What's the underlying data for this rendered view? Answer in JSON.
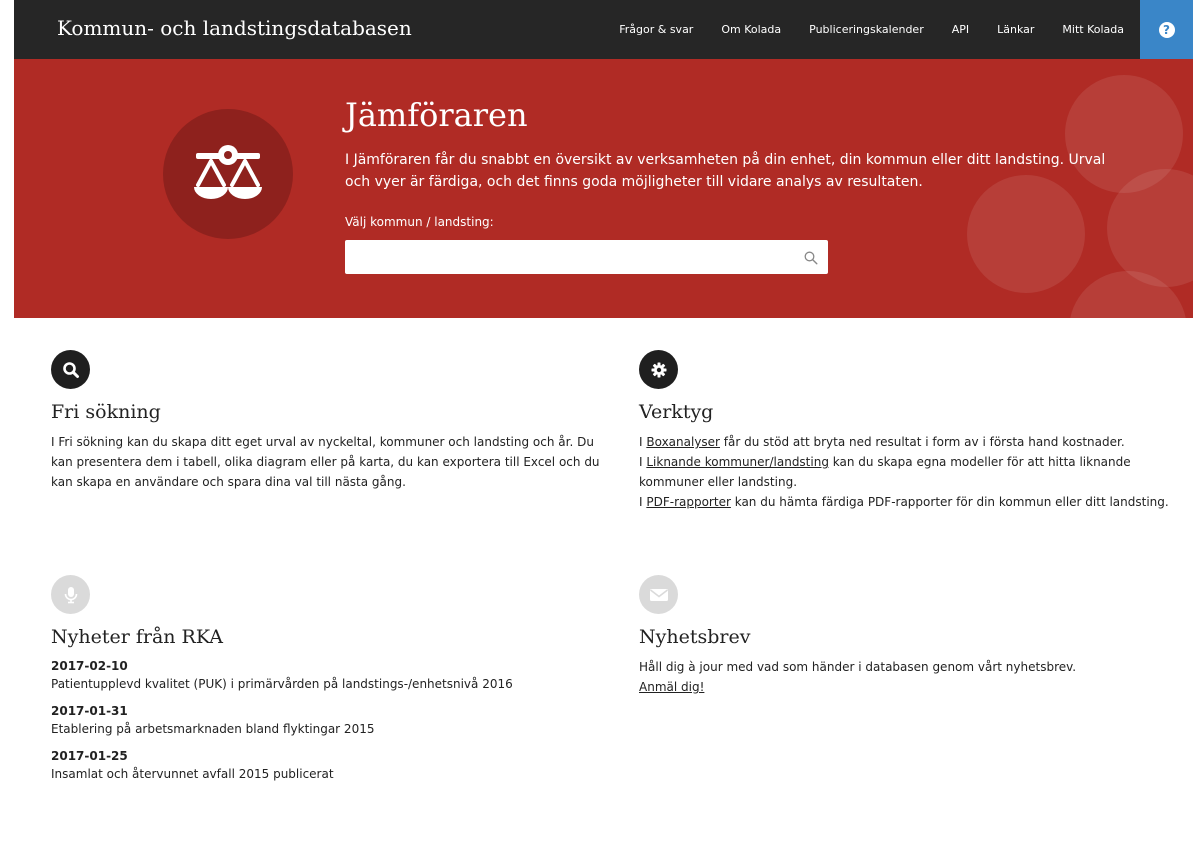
{
  "header": {
    "site_title": "Kommun- och landstingsdatabasen",
    "nav": [
      {
        "label": "Frågor & svar"
      },
      {
        "label": "Om Kolada"
      },
      {
        "label": "Publiceringskalender"
      },
      {
        "label": "API"
      },
      {
        "label": "Länkar"
      },
      {
        "label": "Mitt Kolada"
      }
    ],
    "help_label": "?"
  },
  "hero": {
    "title": "Jämföraren",
    "description": "I Jämföraren får du snabbt en översikt av verksamheten på din enhet, din kommun eller ditt landsting. Urval och vyer är färdiga, och det finns goda möjligheter till vidare analys av resultaten.",
    "search_label": "Välj kommun / landsting:",
    "search_value": "",
    "search_placeholder": "",
    "logo_icon": "scales-icon"
  },
  "sections": {
    "fri_sokning": {
      "icon": "search-icon",
      "title": "Fri sökning",
      "text": "I Fri sökning kan du skapa ditt eget urval av nyckeltal, kommuner och landsting och år. Du kan presentera dem i tabell, olika diagram eller på karta, du kan exportera till Excel och du kan skapa en användare och spara dina val till nästa gång."
    },
    "verktyg": {
      "icon": "gear-icon",
      "title": "Verktyg",
      "lines": [
        {
          "prefix": "I ",
          "link": "Boxanalyser",
          "suffix": " får du stöd att bryta ned resultat i form av i första hand kostnader."
        },
        {
          "prefix": "I ",
          "link": "Liknande kommuner/landsting",
          "suffix": " kan du skapa egna modeller för att hitta liknande kommuner eller landsting."
        },
        {
          "prefix": "I ",
          "link": "PDF-rapporter",
          "suffix": " kan du hämta färdiga PDF-rapporter för din kommun eller ditt landsting."
        }
      ]
    },
    "nyheter": {
      "icon": "microphone-icon",
      "title": "Nyheter från RKA",
      "items": [
        {
          "date": "2017-02-10",
          "title": "Patientupplevd kvalitet (PUK) i primärvården på landstings-/enhetsnivå 2016"
        },
        {
          "date": "2017-01-31",
          "title": "Etablering på arbetsmarknaden bland flyktingar 2015"
        },
        {
          "date": "2017-01-25",
          "title": "Insamlat och återvunnet avfall 2015 publicerat"
        }
      ]
    },
    "nyhetsbrev": {
      "icon": "envelope-icon",
      "title": "Nyhetsbrev",
      "text": "Håll dig à jour med vad som händer i databasen genom vårt nyhetsbrev.",
      "link": "Anmäl dig!"
    }
  },
  "colors": {
    "topbar": "#262626",
    "hero_red": "#b02b25",
    "help_blue": "#3a86c8",
    "dark_icon": "#1f1f1f",
    "light_icon": "#dadada"
  }
}
